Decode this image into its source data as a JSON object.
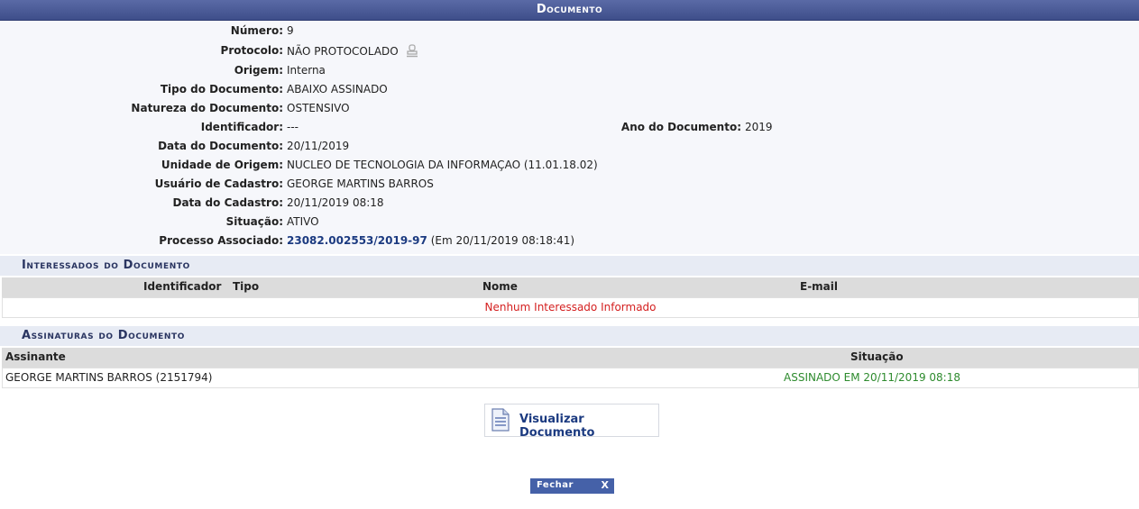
{
  "title": "Documento",
  "info": {
    "numero": {
      "label": "Número:",
      "value": "9"
    },
    "protocolo": {
      "label": "Protocolo:",
      "value": "NÃO PROTOCOLADO"
    },
    "origem": {
      "label": "Origem:",
      "value": "Interna"
    },
    "tipo": {
      "label": "Tipo do Documento:",
      "value": "ABAIXO ASSINADO"
    },
    "natureza": {
      "label": "Natureza do Documento:",
      "value": "OSTENSIVO"
    },
    "identificador": {
      "label": "Identificador:",
      "value": "---"
    },
    "ano": {
      "label": "Ano do Documento:",
      "value": "2019"
    },
    "data_doc": {
      "label": "Data do Documento:",
      "value": "20/11/2019"
    },
    "unidade": {
      "label": "Unidade de Origem:",
      "value": "NUCLEO DE TECNOLOGIA DA INFORMAÇAO (11.01.18.02)"
    },
    "usuario": {
      "label": "Usuário de Cadastro:",
      "value": "GEORGE MARTINS BARROS"
    },
    "data_cadastro": {
      "label": "Data do Cadastro:",
      "value": "20/11/2019 08:18"
    },
    "situacao": {
      "label": "Situação:",
      "value": "ATIVO"
    },
    "processo": {
      "label": "Processo Associado:",
      "link": "23082.002553/2019-97",
      "extra": "(Em 20/11/2019 08:18:41)"
    }
  },
  "interessados": {
    "title": "Interessados do Documento",
    "columns": [
      "Identificador",
      "Tipo",
      "Nome",
      "E-mail"
    ],
    "empty_message": "Nenhum Interessado Informado"
  },
  "assinaturas": {
    "title": "Assinaturas do Documento",
    "columns": [
      "Assinante",
      "Situação"
    ],
    "rows": [
      {
        "assinante": "GEORGE MARTINS BARROS (2151794)",
        "situacao": "ASSINADO EM 20/11/2019 08:18"
      }
    ]
  },
  "actions": {
    "view_label": "Visualizar Documento",
    "close_label": "Fechar",
    "close_x": "X"
  },
  "colors": {
    "header": "#3e4e8a",
    "link": "#1b3a80",
    "empty": "#d42020",
    "signed": "#2e8b2e"
  }
}
